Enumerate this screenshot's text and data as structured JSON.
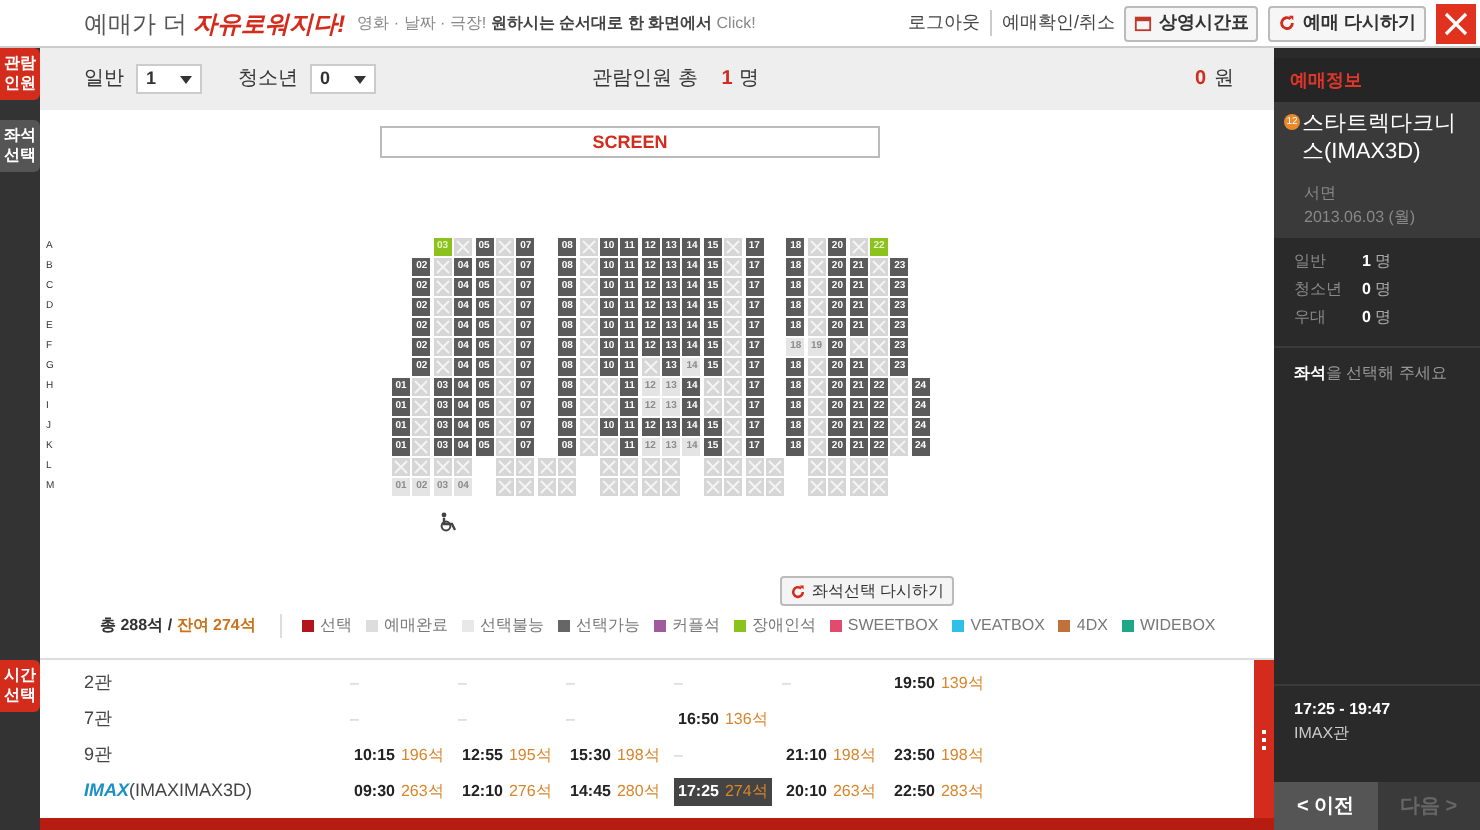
{
  "header": {
    "slogan_prefix": "예매가 더 ",
    "slogan_highlight": "자유로워지다!",
    "tagline_prefix": "영화 · 날짜 · 극장!",
    "tagline_main": "원하시는 순서대로 한 화면에서",
    "tagline_suffix": "Click!",
    "links": [
      "로그아웃",
      "예매확인/취소"
    ],
    "buttons": [
      "상영시간표",
      "예매 다시하기"
    ]
  },
  "steps": [
    {
      "label": "관람인원",
      "done": true
    },
    {
      "label": "좌석선택",
      "done": false
    },
    {
      "label": "시간선택",
      "done": true
    }
  ],
  "audience": {
    "groups": [
      {
        "label": "일반",
        "value": "1"
      },
      {
        "label": "청소년",
        "value": "0"
      }
    ],
    "total_label": "관람인원 총",
    "total_count": "1",
    "total_unit": "명",
    "price": "0",
    "price_unit": "원"
  },
  "screen_label": "SCREEN",
  "seat_rows": [
    {
      "row": "A",
      "seats": [
        {
          "kind": "space"
        },
        {
          "kind": "space"
        },
        {
          "kind": "accessible",
          "label": "03"
        },
        {
          "kind": "sold"
        },
        {
          "kind": "open",
          "label": "05"
        },
        {
          "kind": "sold"
        },
        {
          "kind": "open",
          "label": "07"
        },
        {
          "kind": "space"
        },
        {
          "kind": "open",
          "label": "08"
        },
        {
          "kind": "sold"
        },
        {
          "kind": "open",
          "label": "10"
        },
        {
          "kind": "open",
          "label": "11"
        },
        {
          "kind": "open",
          "label": "12"
        },
        {
          "kind": "open",
          "label": "13"
        },
        {
          "kind": "open",
          "label": "14"
        },
        {
          "kind": "open",
          "label": "15"
        },
        {
          "kind": "sold"
        },
        {
          "kind": "open",
          "label": "17"
        },
        {
          "kind": "space"
        },
        {
          "kind": "open",
          "label": "18"
        },
        {
          "kind": "sold"
        },
        {
          "kind": "open",
          "label": "20"
        },
        {
          "kind": "sold"
        },
        {
          "kind": "accessible",
          "label": "22"
        },
        {
          "kind": "space"
        },
        {
          "kind": "space"
        }
      ]
    },
    {
      "row": "B",
      "seats": [
        {
          "kind": "space"
        },
        {
          "kind": "open",
          "label": "02"
        },
        {
          "kind": "sold"
        },
        {
          "kind": "open",
          "label": "04"
        },
        {
          "kind": "open",
          "label": "05"
        },
        {
          "kind": "sold"
        },
        {
          "kind": "open",
          "label": "07"
        },
        {
          "kind": "space"
        },
        {
          "kind": "open",
          "label": "08"
        },
        {
          "kind": "sold"
        },
        {
          "kind": "open",
          "label": "10"
        },
        {
          "kind": "open",
          "label": "11"
        },
        {
          "kind": "open",
          "label": "12"
        },
        {
          "kind": "open",
          "label": "13"
        },
        {
          "kind": "open",
          "label": "14"
        },
        {
          "kind": "open",
          "label": "15"
        },
        {
          "kind": "sold"
        },
        {
          "kind": "open",
          "label": "17"
        },
        {
          "kind": "space"
        },
        {
          "kind": "open",
          "label": "18"
        },
        {
          "kind": "sold"
        },
        {
          "kind": "open",
          "label": "20"
        },
        {
          "kind": "open",
          "label": "21"
        },
        {
          "kind": "sold"
        },
        {
          "kind": "open",
          "label": "23"
        },
        {
          "kind": "space"
        }
      ]
    },
    {
      "row": "C",
      "seats": [
        {
          "kind": "space"
        },
        {
          "kind": "open",
          "label": "02"
        },
        {
          "kind": "sold"
        },
        {
          "kind": "open",
          "label": "04"
        },
        {
          "kind": "open",
          "label": "05"
        },
        {
          "kind": "sold"
        },
        {
          "kind": "open",
          "label": "07"
        },
        {
          "kind": "space"
        },
        {
          "kind": "open",
          "label": "08"
        },
        {
          "kind": "sold"
        },
        {
          "kind": "open",
          "label": "10"
        },
        {
          "kind": "open",
          "label": "11"
        },
        {
          "kind": "open",
          "label": "12"
        },
        {
          "kind": "open",
          "label": "13"
        },
        {
          "kind": "open",
          "label": "14"
        },
        {
          "kind": "open",
          "label": "15"
        },
        {
          "kind": "sold"
        },
        {
          "kind": "open",
          "label": "17"
        },
        {
          "kind": "space"
        },
        {
          "kind": "open",
          "label": "18"
        },
        {
          "kind": "sold"
        },
        {
          "kind": "open",
          "label": "20"
        },
        {
          "kind": "open",
          "label": "21"
        },
        {
          "kind": "sold"
        },
        {
          "kind": "open",
          "label": "23"
        },
        {
          "kind": "space"
        }
      ]
    },
    {
      "row": "D",
      "seats": [
        {
          "kind": "space"
        },
        {
          "kind": "open",
          "label": "02"
        },
        {
          "kind": "sold"
        },
        {
          "kind": "open",
          "label": "04"
        },
        {
          "kind": "open",
          "label": "05"
        },
        {
          "kind": "sold"
        },
        {
          "kind": "open",
          "label": "07"
        },
        {
          "kind": "space"
        },
        {
          "kind": "open",
          "label": "08"
        },
        {
          "kind": "sold"
        },
        {
          "kind": "open",
          "label": "10"
        },
        {
          "kind": "open",
          "label": "11"
        },
        {
          "kind": "open",
          "label": "12"
        },
        {
          "kind": "open",
          "label": "13"
        },
        {
          "kind": "open",
          "label": "14"
        },
        {
          "kind": "open",
          "label": "15"
        },
        {
          "kind": "sold"
        },
        {
          "kind": "open",
          "label": "17"
        },
        {
          "kind": "space"
        },
        {
          "kind": "open",
          "label": "18"
        },
        {
          "kind": "sold"
        },
        {
          "kind": "open",
          "label": "20"
        },
        {
          "kind": "open",
          "label": "21"
        },
        {
          "kind": "sold"
        },
        {
          "kind": "open",
          "label": "23"
        },
        {
          "kind": "space"
        }
      ]
    },
    {
      "row": "E",
      "seats": [
        {
          "kind": "space"
        },
        {
          "kind": "open",
          "label": "02"
        },
        {
          "kind": "sold"
        },
        {
          "kind": "open",
          "label": "04"
        },
        {
          "kind": "open",
          "label": "05"
        },
        {
          "kind": "sold"
        },
        {
          "kind": "open",
          "label": "07"
        },
        {
          "kind": "space"
        },
        {
          "kind": "open",
          "label": "08"
        },
        {
          "kind": "sold"
        },
        {
          "kind": "open",
          "label": "10"
        },
        {
          "kind": "open",
          "label": "11"
        },
        {
          "kind": "open",
          "label": "12"
        },
        {
          "kind": "open",
          "label": "13"
        },
        {
          "kind": "open",
          "label": "14"
        },
        {
          "kind": "open",
          "label": "15"
        },
        {
          "kind": "sold"
        },
        {
          "kind": "open",
          "label": "17"
        },
        {
          "kind": "space"
        },
        {
          "kind": "open",
          "label": "18"
        },
        {
          "kind": "sold"
        },
        {
          "kind": "open",
          "label": "20"
        },
        {
          "kind": "open",
          "label": "21"
        },
        {
          "kind": "sold"
        },
        {
          "kind": "open",
          "label": "23"
        },
        {
          "kind": "space"
        }
      ]
    },
    {
      "row": "F",
      "seats": [
        {
          "kind": "space"
        },
        {
          "kind": "open",
          "label": "02"
        },
        {
          "kind": "sold"
        },
        {
          "kind": "open",
          "label": "04"
        },
        {
          "kind": "open",
          "label": "05"
        },
        {
          "kind": "sold"
        },
        {
          "kind": "open",
          "label": "07"
        },
        {
          "kind": "space"
        },
        {
          "kind": "open",
          "label": "08"
        },
        {
          "kind": "sold"
        },
        {
          "kind": "open",
          "label": "10"
        },
        {
          "kind": "open",
          "label": "11"
        },
        {
          "kind": "open",
          "label": "12"
        },
        {
          "kind": "open",
          "label": "13"
        },
        {
          "kind": "open",
          "label": "14"
        },
        {
          "kind": "open",
          "label": "15"
        },
        {
          "kind": "sold"
        },
        {
          "kind": "open",
          "label": "17"
        },
        {
          "kind": "space"
        },
        {
          "kind": "blocked",
          "label": "18"
        },
        {
          "kind": "blocked",
          "label": "19"
        },
        {
          "kind": "open",
          "label": "20"
        },
        {
          "kind": "sold"
        },
        {
          "kind": "sold"
        },
        {
          "kind": "open",
          "label": "23"
        },
        {
          "kind": "space"
        }
      ]
    },
    {
      "row": "G",
      "seats": [
        {
          "kind": "space"
        },
        {
          "kind": "open",
          "label": "02"
        },
        {
          "kind": "sold"
        },
        {
          "kind": "open",
          "label": "04"
        },
        {
          "kind": "open",
          "label": "05"
        },
        {
          "kind": "sold"
        },
        {
          "kind": "open",
          "label": "07"
        },
        {
          "kind": "space"
        },
        {
          "kind": "open",
          "label": "08"
        },
        {
          "kind": "sold"
        },
        {
          "kind": "open",
          "label": "10"
        },
        {
          "kind": "open",
          "label": "11"
        },
        {
          "kind": "sold"
        },
        {
          "kind": "open",
          "label": "13"
        },
        {
          "kind": "blocked",
          "label": "14"
        },
        {
          "kind": "open",
          "label": "15"
        },
        {
          "kind": "sold"
        },
        {
          "kind": "open",
          "label": "17"
        },
        {
          "kind": "space"
        },
        {
          "kind": "open",
          "label": "18"
        },
        {
          "kind": "sold"
        },
        {
          "kind": "open",
          "label": "20"
        },
        {
          "kind": "open",
          "label": "21"
        },
        {
          "kind": "sold"
        },
        {
          "kind": "open",
          "label": "23"
        },
        {
          "kind": "space"
        }
      ]
    },
    {
      "row": "H",
      "seats": [
        {
          "kind": "open",
          "label": "01"
        },
        {
          "kind": "sold"
        },
        {
          "kind": "open",
          "label": "03"
        },
        {
          "kind": "open",
          "label": "04"
        },
        {
          "kind": "open",
          "label": "05"
        },
        {
          "kind": "sold"
        },
        {
          "kind": "open",
          "label": "07"
        },
        {
          "kind": "space"
        },
        {
          "kind": "open",
          "label": "08"
        },
        {
          "kind": "sold"
        },
        {
          "kind": "sold"
        },
        {
          "kind": "open",
          "label": "11"
        },
        {
          "kind": "blocked",
          "label": "12"
        },
        {
          "kind": "blocked",
          "label": "13"
        },
        {
          "kind": "open",
          "label": "14"
        },
        {
          "kind": "sold"
        },
        {
          "kind": "sold"
        },
        {
          "kind": "open",
          "label": "17"
        },
        {
          "kind": "space"
        },
        {
          "kind": "open",
          "label": "18"
        },
        {
          "kind": "sold"
        },
        {
          "kind": "open",
          "label": "20"
        },
        {
          "kind": "open",
          "label": "21"
        },
        {
          "kind": "open",
          "label": "22"
        },
        {
          "kind": "sold"
        },
        {
          "kind": "open",
          "label": "24"
        }
      ]
    },
    {
      "row": "I",
      "seats": [
        {
          "kind": "open",
          "label": "01"
        },
        {
          "kind": "sold"
        },
        {
          "kind": "open",
          "label": "03"
        },
        {
          "kind": "open",
          "label": "04"
        },
        {
          "kind": "open",
          "label": "05"
        },
        {
          "kind": "sold"
        },
        {
          "kind": "open",
          "label": "07"
        },
        {
          "kind": "space"
        },
        {
          "kind": "open",
          "label": "08"
        },
        {
          "kind": "sold"
        },
        {
          "kind": "sold"
        },
        {
          "kind": "open",
          "label": "11"
        },
        {
          "kind": "blocked",
          "label": "12"
        },
        {
          "kind": "blocked",
          "label": "13"
        },
        {
          "kind": "open",
          "label": "14"
        },
        {
          "kind": "sold"
        },
        {
          "kind": "sold"
        },
        {
          "kind": "open",
          "label": "17"
        },
        {
          "kind": "space"
        },
        {
          "kind": "open",
          "label": "18"
        },
        {
          "kind": "sold"
        },
        {
          "kind": "open",
          "label": "20"
        },
        {
          "kind": "open",
          "label": "21"
        },
        {
          "kind": "open",
          "label": "22"
        },
        {
          "kind": "sold"
        },
        {
          "kind": "open",
          "label": "24"
        }
      ]
    },
    {
      "row": "J",
      "seats": [
        {
          "kind": "open",
          "label": "01"
        },
        {
          "kind": "sold"
        },
        {
          "kind": "open",
          "label": "03"
        },
        {
          "kind": "open",
          "label": "04"
        },
        {
          "kind": "open",
          "label": "05"
        },
        {
          "kind": "sold"
        },
        {
          "kind": "open",
          "label": "07"
        },
        {
          "kind": "space"
        },
        {
          "kind": "open",
          "label": "08"
        },
        {
          "kind": "sold"
        },
        {
          "kind": "open",
          "label": "10"
        },
        {
          "kind": "open",
          "label": "11"
        },
        {
          "kind": "open",
          "label": "12"
        },
        {
          "kind": "open",
          "label": "13"
        },
        {
          "kind": "open",
          "label": "14"
        },
        {
          "kind": "open",
          "label": "15"
        },
        {
          "kind": "sold"
        },
        {
          "kind": "open",
          "label": "17"
        },
        {
          "kind": "space"
        },
        {
          "kind": "open",
          "label": "18"
        },
        {
          "kind": "sold"
        },
        {
          "kind": "open",
          "label": "20"
        },
        {
          "kind": "open",
          "label": "21"
        },
        {
          "kind": "open",
          "label": "22"
        },
        {
          "kind": "sold"
        },
        {
          "kind": "open",
          "label": "24"
        }
      ]
    },
    {
      "row": "K",
      "seats": [
        {
          "kind": "open",
          "label": "01"
        },
        {
          "kind": "sold"
        },
        {
          "kind": "open",
          "label": "03"
        },
        {
          "kind": "open",
          "label": "04"
        },
        {
          "kind": "open",
          "label": "05"
        },
        {
          "kind": "sold"
        },
        {
          "kind": "open",
          "label": "07"
        },
        {
          "kind": "space"
        },
        {
          "kind": "open",
          "label": "08"
        },
        {
          "kind": "sold"
        },
        {
          "kind": "sold"
        },
        {
          "kind": "open",
          "label": "11"
        },
        {
          "kind": "blocked",
          "label": "12"
        },
        {
          "kind": "blocked",
          "label": "13"
        },
        {
          "kind": "blocked",
          "label": "14"
        },
        {
          "kind": "open",
          "label": "15"
        },
        {
          "kind": "sold"
        },
        {
          "kind": "open",
          "label": "17"
        },
        {
          "kind": "space"
        },
        {
          "kind": "open",
          "label": "18"
        },
        {
          "kind": "sold"
        },
        {
          "kind": "open",
          "label": "20"
        },
        {
          "kind": "open",
          "label": "21"
        },
        {
          "kind": "open",
          "label": "22"
        },
        {
          "kind": "sold"
        },
        {
          "kind": "open",
          "label": "24"
        }
      ]
    },
    {
      "row": "L",
      "seats": [
        {
          "kind": "sold"
        },
        {
          "kind": "sold"
        },
        {
          "kind": "sold"
        },
        {
          "kind": "sold"
        },
        {
          "kind": "space"
        },
        {
          "kind": "sold"
        },
        {
          "kind": "sold"
        },
        {
          "kind": "sold"
        },
        {
          "kind": "sold"
        },
        {
          "kind": "space"
        },
        {
          "kind": "sold"
        },
        {
          "kind": "sold"
        },
        {
          "kind": "sold"
        },
        {
          "kind": "sold"
        },
        {
          "kind": "space"
        },
        {
          "kind": "sold"
        },
        {
          "kind": "sold"
        },
        {
          "kind": "sold"
        },
        {
          "kind": "sold"
        },
        {
          "kind": "space"
        },
        {
          "kind": "sold"
        },
        {
          "kind": "sold"
        },
        {
          "kind": "sold"
        },
        {
          "kind": "sold"
        },
        {
          "kind": "space"
        },
        {
          "kind": "space"
        }
      ]
    },
    {
      "row": "M",
      "seats": [
        {
          "kind": "blocked",
          "label": "01"
        },
        {
          "kind": "blocked",
          "label": "02"
        },
        {
          "kind": "blocked",
          "label": "03"
        },
        {
          "kind": "blocked",
          "label": "04"
        },
        {
          "kind": "space"
        },
        {
          "kind": "sold"
        },
        {
          "kind": "sold"
        },
        {
          "kind": "sold"
        },
        {
          "kind": "sold"
        },
        {
          "kind": "space"
        },
        {
          "kind": "sold"
        },
        {
          "kind": "sold"
        },
        {
          "kind": "sold"
        },
        {
          "kind": "sold"
        },
        {
          "kind": "space"
        },
        {
          "kind": "sold"
        },
        {
          "kind": "sold"
        },
        {
          "kind": "sold"
        },
        {
          "kind": "sold"
        },
        {
          "kind": "space"
        },
        {
          "kind": "sold"
        },
        {
          "kind": "sold"
        },
        {
          "kind": "sold"
        },
        {
          "kind": "sold"
        },
        {
          "kind": "space"
        },
        {
          "kind": "space"
        }
      ]
    }
  ],
  "reset_seats_button": "좌석선택 다시하기",
  "seat_summary": {
    "total": "총 288석",
    "separator": "/",
    "remaining": "잔여 274석"
  },
  "legend": [
    {
      "label": "선택",
      "color": "#b2151b"
    },
    {
      "label": "예매완료",
      "color": "#dddddd"
    },
    {
      "label": "선택불능",
      "color": "#e8e8e8"
    },
    {
      "label": "선택가능",
      "color": "#666666"
    },
    {
      "label": "커플석",
      "color": "#a05b9c"
    },
    {
      "label": "장애인석",
      "color": "#8cc21e"
    },
    {
      "label": "SWEETBOX",
      "color": "#e24b6e"
    },
    {
      "label": "VEATBOX",
      "color": "#2fc0ea"
    },
    {
      "label": "4DX",
      "color": "#c0713c"
    },
    {
      "label": "WIDEBOX",
      "color": "#1fa886"
    }
  ],
  "showtimes": [
    {
      "hall": "2관",
      "slots": [
        {
          "kind": "dash",
          "text": "–"
        },
        {
          "kind": "dash",
          "text": "–"
        },
        {
          "kind": "dash",
          "text": "–"
        },
        {
          "kind": "dash",
          "text": "–"
        },
        {
          "kind": "dash",
          "text": "–"
        },
        {
          "kind": "time",
          "time": "19:50",
          "seats": "139석",
          "selected": false
        }
      ]
    },
    {
      "hall": "7관",
      "slots": [
        {
          "kind": "dash",
          "text": "–"
        },
        {
          "kind": "dash",
          "text": "–"
        },
        {
          "kind": "dash",
          "text": "–"
        },
        {
          "kind": "time",
          "time": "16:50",
          "seats": "136석",
          "selected": false
        }
      ]
    },
    {
      "hall": "9관",
      "slots": [
        {
          "kind": "time",
          "time": "10:15",
          "seats": "196석",
          "selected": false
        },
        {
          "kind": "time",
          "time": "12:55",
          "seats": "195석",
          "selected": false
        },
        {
          "kind": "time",
          "time": "15:30",
          "seats": "198석",
          "selected": false
        },
        {
          "kind": "dash",
          "text": "–"
        },
        {
          "kind": "time",
          "time": "21:10",
          "seats": "198석",
          "selected": false
        },
        {
          "kind": "time",
          "time": "23:50",
          "seats": "198석",
          "selected": false
        }
      ]
    },
    {
      "hall_logo": "IMAX",
      "hall": "(IMAXIMAX3D)",
      "slots": [
        {
          "kind": "time",
          "time": "09:30",
          "seats": "263석",
          "selected": false
        },
        {
          "kind": "time",
          "time": "12:10",
          "seats": "276석",
          "selected": false
        },
        {
          "kind": "time",
          "time": "14:45",
          "seats": "280석",
          "selected": false
        },
        {
          "kind": "time",
          "time": "17:25",
          "seats": "274석",
          "selected": true
        },
        {
          "kind": "time",
          "time": "20:10",
          "seats": "263석",
          "selected": false
        },
        {
          "kind": "time",
          "time": "22:50",
          "seats": "283석",
          "selected": false
        }
      ]
    }
  ],
  "booking_info": {
    "title": "예매정보",
    "rating": "12",
    "movie": "스타트렉다크니스(IMAX3D)",
    "theater": "서면",
    "date": "2013.06.03 (월)",
    "tickets": [
      {
        "label": "일반",
        "count": "1",
        "unit": "명"
      },
      {
        "label": "청소년",
        "count": "0",
        "unit": "명"
      },
      {
        "label": "우대",
        "count": "0",
        "unit": "명"
      }
    ],
    "seat_prompt_bold": "좌석",
    "seat_prompt": "을 선택해 주세요",
    "time": "17:25 - 19:47",
    "hall": "IMAX관",
    "nav": [
      {
        "label": "< 이전",
        "disabled": false
      },
      {
        "label": "다음 >",
        "disabled": true
      }
    ]
  }
}
